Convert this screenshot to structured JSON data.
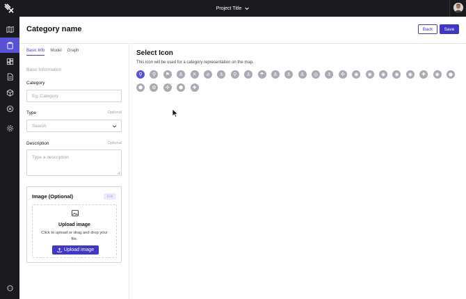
{
  "topbar": {
    "project_title": "Project Title"
  },
  "header": {
    "title": "Category name",
    "back_label": "Back",
    "save_label": "Save"
  },
  "tabs": [
    {
      "label": "Basic Info",
      "active": true
    },
    {
      "label": "Model",
      "active": false
    },
    {
      "label": "Graph",
      "active": false
    }
  ],
  "form": {
    "section_label": "Basic Information",
    "category": {
      "label": "Category",
      "placeholder": "Eg.:Category"
    },
    "type": {
      "label": "Type",
      "optional": "Optional",
      "placeholder": "Search"
    },
    "description": {
      "label": "Description",
      "optional": "Optional",
      "placeholder": "Type a description"
    }
  },
  "image": {
    "title": "Image (Optional)",
    "edit_label": "Edit",
    "upload_title": "Upload image",
    "upload_help": "Click to upload or drag and drop your file.",
    "upload_button": "Upload image"
  },
  "icon_picker": {
    "title": "Select Icon",
    "help": "This icon will be used for a category representation on the map.",
    "icons": [
      "⚲",
      "⚲",
      "⚑",
      "⚓",
      "✕",
      "⌀",
      "⚓",
      "⚲",
      "⚓",
      "☂",
      "⚓",
      "⚓",
      "⚓",
      "◎",
      "⚓",
      "✣",
      "◉",
      "◉",
      "◉",
      "◉",
      "◉",
      "✚",
      "◉",
      "●",
      "⬢",
      "⚙",
      "✣",
      "⬢",
      "✚"
    ]
  },
  "colors": {
    "accent": "#3f37c9",
    "sidebar_active": "#5a51d9",
    "dark_bar": "#1b1b1f",
    "icon_gray": "#a8abb3"
  }
}
